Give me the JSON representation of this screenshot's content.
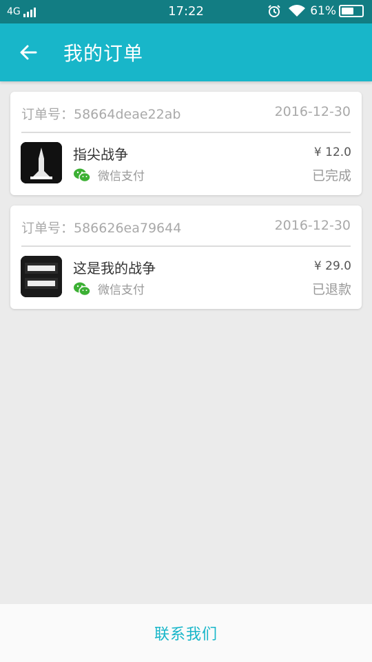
{
  "status_bar": {
    "network": "4G",
    "time": "17:22",
    "battery_percent": "61%",
    "battery_level": 0.61,
    "icons": [
      "signal-icon",
      "alarm-icon",
      "wifi-icon",
      "battery-icon"
    ]
  },
  "header": {
    "title": "我的订单",
    "back_icon": "arrow-left-icon"
  },
  "orders": [
    {
      "id": "订单号：58664deae22ab",
      "date": "2016-12-30",
      "game": "指尖战争",
      "payment": "微信支付",
      "price": "¥ 12.0",
      "status": "已完成"
    },
    {
      "id": "订单号：586626ea79644",
      "date": "2016-12-30",
      "game": "这是我的战争",
      "payment": "微信支付",
      "price": "¥ 29.0",
      "status": "已退款"
    }
  ],
  "footer": {
    "contact_label": "联系我们"
  },
  "colors": {
    "status_bar": "#127d83",
    "app_bar": "#18b6c9",
    "wechat_green": "#3cb034",
    "background": "#ebebeb"
  }
}
